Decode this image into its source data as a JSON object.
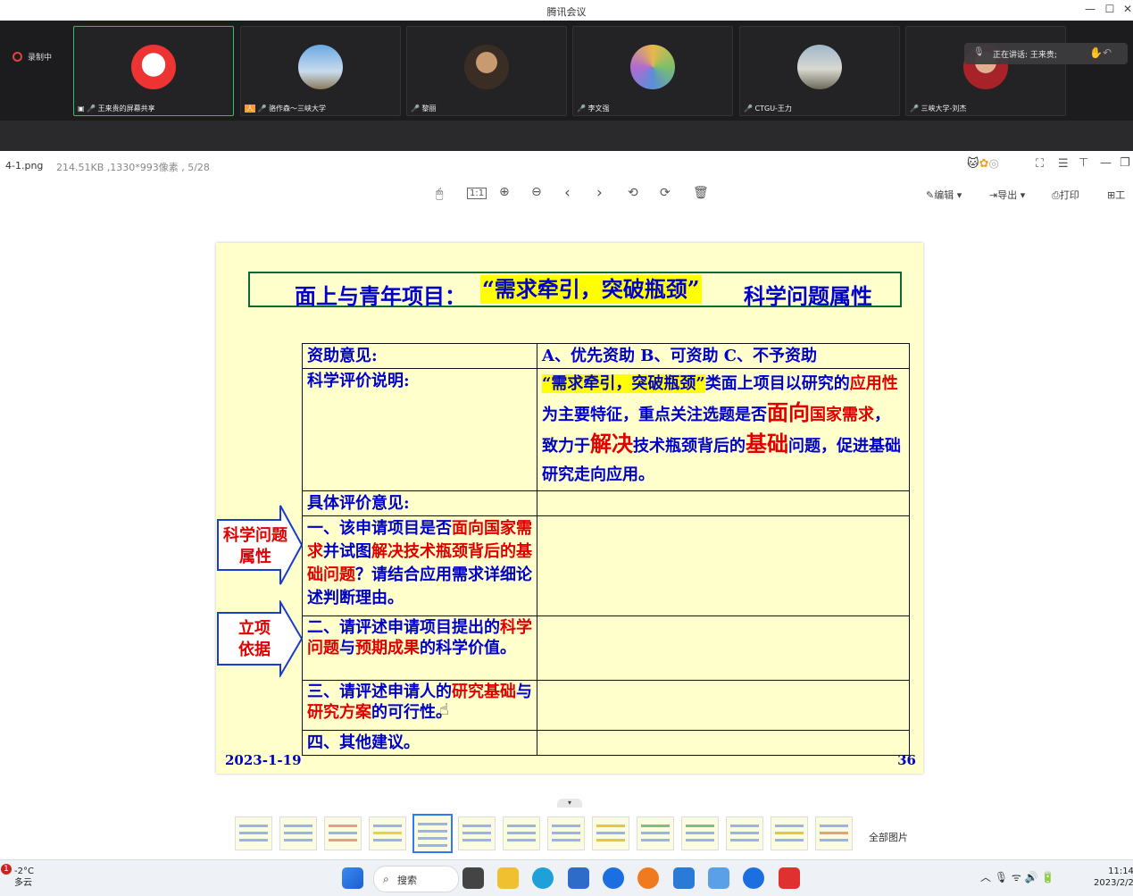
{
  "app": {
    "title": "腾讯会议"
  },
  "meeting": {
    "recording": "录制中",
    "speaking": "正在讲话: 王来贵;",
    "participants": [
      {
        "name": "王来贵的屏幕共享"
      },
      {
        "name": "骆作森～三峡大学"
      },
      {
        "name": "黎丽"
      },
      {
        "name": "李文强"
      },
      {
        "name": "CTGU-王力"
      },
      {
        "name": "三峡大学-刘杰"
      }
    ]
  },
  "viewer": {
    "filename": "4-1.png",
    "meta": "214.51KB ,1330*993像素 , 5/28",
    "toolbar": {
      "ratio": "1:1",
      "edit": "编辑",
      "export": "导出",
      "print": "打印",
      "more": "工"
    },
    "all_pictures": "全部图片"
  },
  "slide": {
    "title_pre": "面上与青年项目：",
    "title_hl": "“需求牵引，突破瓶颈”",
    "title_post": "科学问题属性",
    "rows": {
      "r1_label": "资助意见:",
      "r1_value": "A、优先资助 B、可资助 C、不予资助",
      "r2_label": "科学评价说明:",
      "r2_hl": "“需求牵引，突破瓶颈”",
      "r2_a": "类面上项目以研究的",
      "r2_b": "应用性",
      "r2_c": "为主要特征，重点关注选题是否",
      "r2_d": "面向",
      "r2_e": "国家需求",
      "r2_f": "，致力于",
      "r2_g": "解决",
      "r2_h": "技术瓶颈背后的",
      "r2_i": "基础",
      "r2_j": "问题，促进基础研究走向应用。",
      "r3_label": "具体评价意见:",
      "q1_a": "一、该申请项目是否",
      "q1_b": "面向国家需求",
      "q1_c": "并试图",
      "q1_d": "解决技术瓶颈背后的基础问题",
      "q1_e": "？请结合应用需求详细论述判断理由。",
      "q2_a": "二、请评述申请项目提出的",
      "q2_b": "科学问题",
      "q2_c": "与",
      "q2_d": "预期成果",
      "q2_e": "的科学价值。",
      "q3_a": "三、请评述申请人的",
      "q3_b": "研究基础",
      "q3_c": "与",
      "q3_d": "研究方案",
      "q3_e": "的可行性。",
      "q4": "四、其他建议。"
    },
    "arrow1": "科学问题属性",
    "arrow2": "立项依据",
    "date": "2023-1-19",
    "page": "36"
  },
  "taskbar": {
    "notification_count": "1",
    "temp": "-2°C",
    "weather": "多云",
    "search": "搜索",
    "time": "11:14",
    "date": "2023/2/2"
  }
}
